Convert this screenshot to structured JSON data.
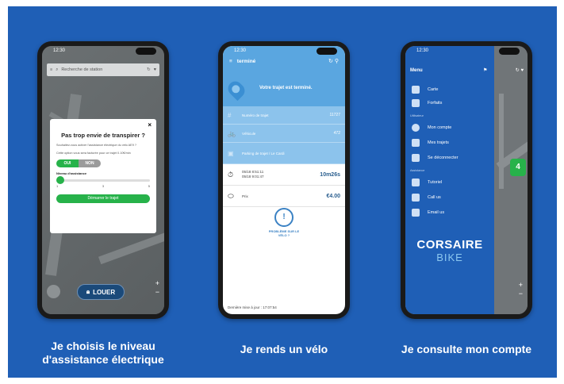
{
  "captions": {
    "left_line1": "Je choisis le niveau",
    "left_line2": "d'assistance électrique",
    "middle": "Je rends un vélo",
    "right": "Je consulte mon compte"
  },
  "phone1": {
    "status_time": "12:30",
    "search_placeholder": "Recherche de station",
    "dialog": {
      "close": "×",
      "title": "Pas trop envie de transpirer ?",
      "text1": "Souhaitez-vous activer l'assistance électrique du vélo AE9 ?",
      "text2": "Cette option vous sera facturée pour ce trajet 0.10€/min",
      "toggle_on": "OUI",
      "toggle_off": "NON",
      "level_label": "Niveau d'assistance",
      "ticks": [
        "1",
        "3",
        "5"
      ],
      "start_button": "Démarrer le trajet",
      "slider_level_fraction": 0
    },
    "rent_button": "LOUER",
    "zoom_in": "+",
    "zoom_out": "−"
  },
  "phone2": {
    "status_time": "12:30",
    "header_title": "terminé",
    "done_text": "Votre trajet est terminé.",
    "rows": [
      {
        "icon": "#",
        "label": "Numéro de trajet",
        "value": "11727"
      },
      {
        "icon": "🚲",
        "label": "Véhicule",
        "value": "472"
      },
      {
        "icon": "▣",
        "label": "Parking de trajet / Le Cardi",
        "value": ""
      }
    ],
    "time_row": {
      "icon": "⏱",
      "start": "05/18 8:51:11",
      "end": "05/18 9:01:47",
      "value": "10m26s"
    },
    "price_row": {
      "icon": "⬭",
      "label": "Prix",
      "value": "€4.00"
    },
    "problem": {
      "symbol": "!",
      "text": "PROBLÈME SUR LE VÉLO ?"
    },
    "last_update": "Dernière mise à jour : 17:07:54"
  },
  "phone3": {
    "status_time": "12:30",
    "menu_title": "Menu",
    "items_main": [
      {
        "label": "Carte"
      },
      {
        "label": "Forfaits"
      }
    ],
    "section_user": "Utilisateur",
    "items_user": [
      {
        "label": "Mon compte"
      },
      {
        "label": "Mes trajets"
      },
      {
        "label": "Se déconnecter"
      }
    ],
    "section_help": "Assistance",
    "items_help": [
      {
        "label": "Tutoriel"
      },
      {
        "label": "Call us"
      },
      {
        "label": "Email us"
      }
    ],
    "logo_line1": "CORSAIRE",
    "logo_line2": "BIKE",
    "map_badge": "4",
    "zoom_in": "+",
    "zoom_out": "−"
  }
}
